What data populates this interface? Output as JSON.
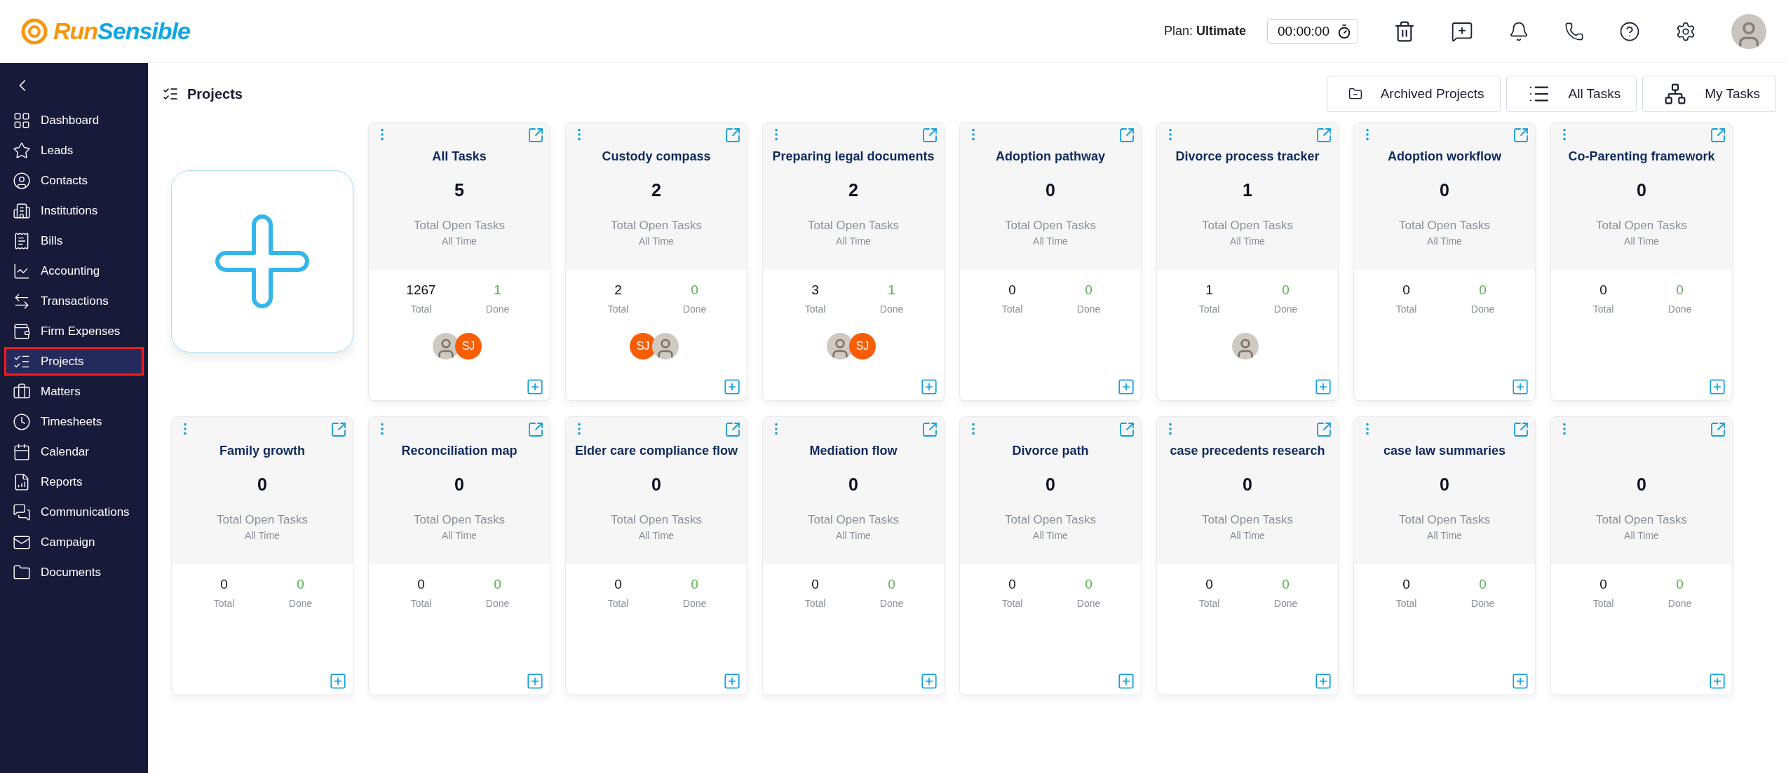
{
  "brand": {
    "part_1": "Run",
    "part_2": "Sensible"
  },
  "header": {
    "plan_label": "Plan:",
    "plan_name": "Ultimate",
    "timer": "00:00:00"
  },
  "sidebar": {
    "items": [
      {
        "label": "Dashboard",
        "selected": false
      },
      {
        "label": "Leads",
        "selected": false
      },
      {
        "label": "Contacts",
        "selected": false
      },
      {
        "label": "Institutions",
        "selected": false
      },
      {
        "label": "Bills",
        "selected": false
      },
      {
        "label": "Accounting",
        "selected": false
      },
      {
        "label": "Transactions",
        "selected": false
      },
      {
        "label": "Firm Expenses",
        "selected": false
      },
      {
        "label": "Projects",
        "selected": true
      },
      {
        "label": "Matters",
        "selected": false
      },
      {
        "label": "Timesheets",
        "selected": false
      },
      {
        "label": "Calendar",
        "selected": false
      },
      {
        "label": "Reports",
        "selected": false
      },
      {
        "label": "Communications",
        "selected": false
      },
      {
        "label": "Campaign",
        "selected": false
      },
      {
        "label": "Documents",
        "selected": false
      }
    ]
  },
  "page": {
    "title": "Projects",
    "actions": [
      {
        "label": "Archived Projects"
      },
      {
        "label": "All Tasks"
      },
      {
        "label": "My Tasks"
      }
    ]
  },
  "projects": [
    {
      "title": "All Tasks",
      "open": "5",
      "open_label": "Total Open Tasks",
      "period": "All Time",
      "total": "1267",
      "total_label": "Total",
      "done": "1",
      "done_label": "Done",
      "members": [
        {
          "kind": "photo"
        },
        {
          "kind": "initials",
          "text": "SJ"
        }
      ]
    },
    {
      "title": "Custody compass",
      "open": "2",
      "open_label": "Total Open Tasks",
      "period": "All Time",
      "total": "2",
      "total_label": "Total",
      "done": "0",
      "done_label": "Done",
      "members": [
        {
          "kind": "initials",
          "text": "SJ"
        },
        {
          "kind": "photo"
        }
      ]
    },
    {
      "title": "Preparing legal documents",
      "open": "2",
      "open_label": "Total Open Tasks",
      "period": "All Time",
      "total": "3",
      "total_label": "Total",
      "done": "1",
      "done_label": "Done",
      "members": [
        {
          "kind": "photo"
        },
        {
          "kind": "initials",
          "text": "SJ"
        }
      ]
    },
    {
      "title": "Adoption pathway",
      "open": "0",
      "open_label": "Total Open Tasks",
      "period": "All Time",
      "total": "0",
      "total_label": "Total",
      "done": "0",
      "done_label": "Done"
    },
    {
      "title": "Divorce process tracker",
      "open": "1",
      "open_label": "Total Open Tasks",
      "period": "All Time",
      "total": "1",
      "total_label": "Total",
      "done": "0",
      "done_label": "Done",
      "members": [
        {
          "kind": "photo"
        }
      ]
    },
    {
      "title": "Adoption workflow",
      "open": "0",
      "open_label": "Total Open Tasks",
      "period": "All Time",
      "total": "0",
      "total_label": "Total",
      "done": "0",
      "done_label": "Done"
    },
    {
      "title": "Co-Parenting framework",
      "open": "0",
      "open_label": "Total Open Tasks",
      "period": "All Time",
      "total": "0",
      "total_label": "Total",
      "done": "0",
      "done_label": "Done"
    },
    {
      "title": "Family growth",
      "open": "0",
      "open_label": "Total Open Tasks",
      "period": "All Time",
      "total": "0",
      "total_label": "Total",
      "done": "0",
      "done_label": "Done"
    },
    {
      "title": "Reconciliation map",
      "open": "0",
      "open_label": "Total Open Tasks",
      "period": "All Time",
      "total": "0",
      "total_label": "Total",
      "done": "0",
      "done_label": "Done"
    },
    {
      "title": "Elder care compliance flow",
      "open": "0",
      "open_label": "Total Open Tasks",
      "period": "All Time",
      "total": "0",
      "total_label": "Total",
      "done": "0",
      "done_label": "Done"
    },
    {
      "title": "Mediation flow",
      "open": "0",
      "open_label": "Total Open Tasks",
      "period": "All Time",
      "total": "0",
      "total_label": "Total",
      "done": "0",
      "done_label": "Done"
    },
    {
      "title": "Divorce path",
      "open": "0",
      "open_label": "Total Open Tasks",
      "period": "All Time",
      "total": "0",
      "total_label": "Total",
      "done": "0",
      "done_label": "Done"
    },
    {
      "title": "case precedents research",
      "open": "0",
      "open_label": "Total Open Tasks",
      "period": "All Time",
      "total": "0",
      "total_label": "Total",
      "done": "0",
      "done_label": "Done"
    },
    {
      "title": "case law summaries",
      "open": "0",
      "open_label": "Total Open Tasks",
      "period": "All Time",
      "total": "0",
      "total_label": "Total",
      "done": "0",
      "done_label": "Done"
    },
    {
      "open": "0",
      "open_label": "Total Open Tasks",
      "period": "All Time",
      "total": "0",
      "total_label": "Total",
      "done": "0",
      "done_label": "Done"
    }
  ]
}
